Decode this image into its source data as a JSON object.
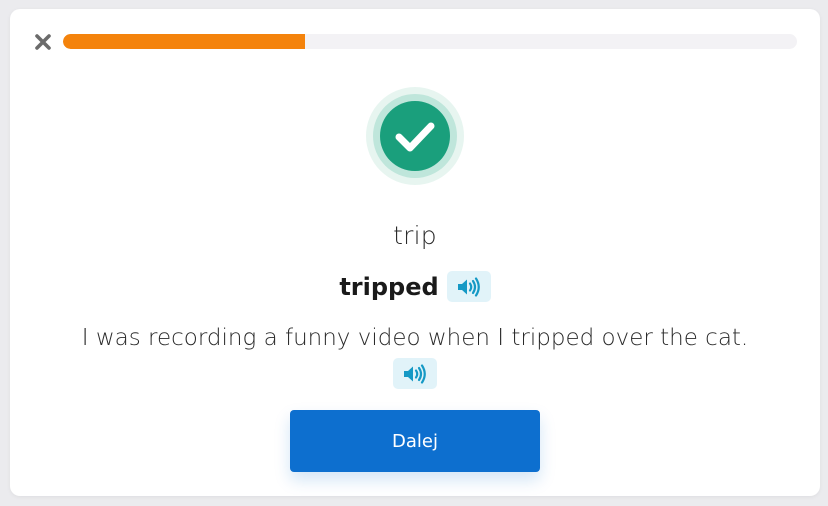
{
  "progress": {
    "fraction": 0.33
  },
  "colors": {
    "progress_fill": "#f4830c",
    "progress_track": "#f3f2f5",
    "check_inner": "#1a9f7c",
    "check_ring": "#bfe6db",
    "audio_bg": "#e1f3f9",
    "audio_icon": "#1599c5",
    "button_bg": "#0d6fcf"
  },
  "icons": {
    "close": "close-icon",
    "check": "checkmark-icon",
    "audio": "speaker-icon"
  },
  "card": {
    "base_word": "trip",
    "word_form": "tripped",
    "sentence": "I was recording a funny video when I tripped over the cat."
  },
  "next_button": {
    "label": "Dalej"
  }
}
